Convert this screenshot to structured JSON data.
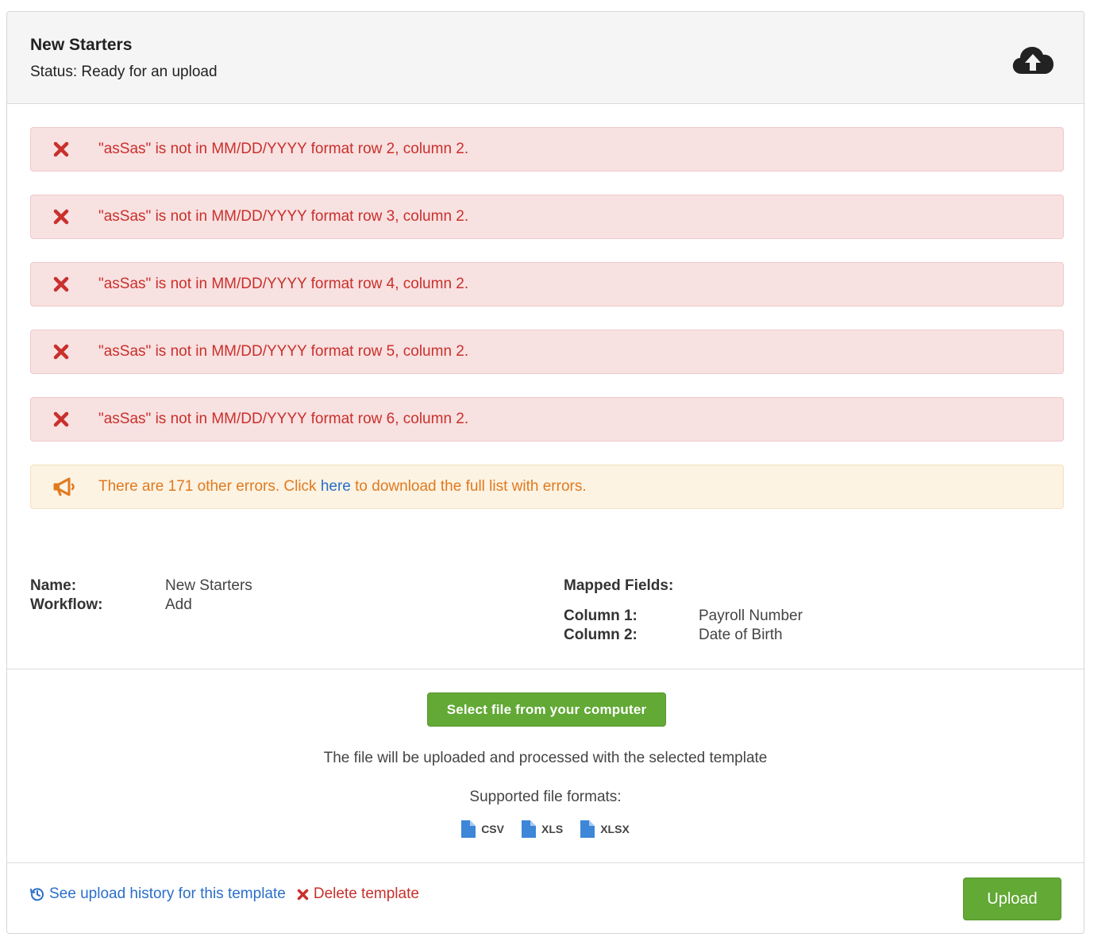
{
  "header": {
    "title": "New Starters",
    "status": "Status: Ready for an upload"
  },
  "errors": [
    "\"asSas\" is not in MM/DD/YYYY format row 2, column 2.",
    "\"asSas\" is not in MM/DD/YYYY format row 3, column 2.",
    "\"asSas\" is not in MM/DD/YYYY format row 4, column 2.",
    "\"asSas\" is not in MM/DD/YYYY format row 5, column 2.",
    "\"asSas\" is not in MM/DD/YYYY format row 6, column 2."
  ],
  "warning": {
    "prefix": "There are 171 other errors. Click ",
    "link": "here",
    "suffix": " to download the full list with errors."
  },
  "details": {
    "name_label": "Name:",
    "name_value": "New Starters",
    "workflow_label": "Workflow:",
    "workflow_value": "Add",
    "mapped_title": "Mapped Fields:",
    "columns": [
      {
        "label": "Column 1:",
        "value": "Payroll Number"
      },
      {
        "label": "Column 2:",
        "value": "Date of Birth"
      }
    ]
  },
  "upload_area": {
    "select_button": "Select file from your computer",
    "info": "The file will be uploaded and processed with the selected template",
    "formats_title": "Supported file formats:",
    "formats": [
      "CSV",
      "XLS",
      "XLSX"
    ]
  },
  "footer": {
    "history_link": "See upload history for this template",
    "delete_link": "Delete template",
    "upload_button": "Upload"
  },
  "colors": {
    "danger_text": "#c9302c",
    "danger_bg": "#f8e1e1",
    "warning_text": "#e07a1f",
    "warning_bg": "#fcf3e3",
    "link": "#2a6fc9",
    "success": "#62a935",
    "file_icon": "#3d86d8"
  }
}
